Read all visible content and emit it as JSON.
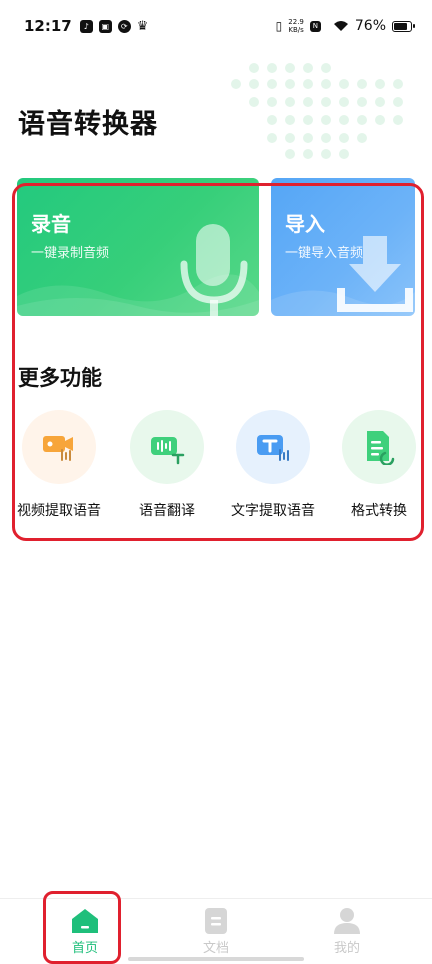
{
  "status_bar": {
    "time": "12:17",
    "net_speed_value": "22.9",
    "net_speed_unit": "KB/s",
    "battery": "76%"
  },
  "header": {
    "title": "语音转换器"
  },
  "cards": {
    "record": {
      "title": "录音",
      "subtitle": "一键录制音频",
      "icon": "microphone-icon"
    },
    "import": {
      "title": "导入",
      "subtitle": "一键导入音频",
      "icon": "download-icon"
    }
  },
  "more": {
    "title": "更多功能",
    "features": [
      {
        "label": "视频提取语音",
        "icon": "video-audio-icon",
        "color": "#f7a53a"
      },
      {
        "label": "语音翻译",
        "icon": "voice-translate-icon",
        "color": "#3fd07c"
      },
      {
        "label": "文字提取语音",
        "icon": "text-to-speech-icon",
        "color": "#4a9cf2"
      },
      {
        "label": "格式转换",
        "icon": "format-convert-icon",
        "color": "#3fd07c"
      }
    ]
  },
  "bottom_nav": {
    "items": [
      {
        "label": "首页",
        "icon": "home-icon",
        "active": true
      },
      {
        "label": "文档",
        "icon": "document-icon",
        "active": false
      },
      {
        "label": "我的",
        "icon": "profile-icon",
        "active": false
      }
    ]
  },
  "colors": {
    "accent": "#1fbf7b",
    "record_card": "#23c97e",
    "import_card": "#55a6f6",
    "highlight": "#e0202e"
  }
}
